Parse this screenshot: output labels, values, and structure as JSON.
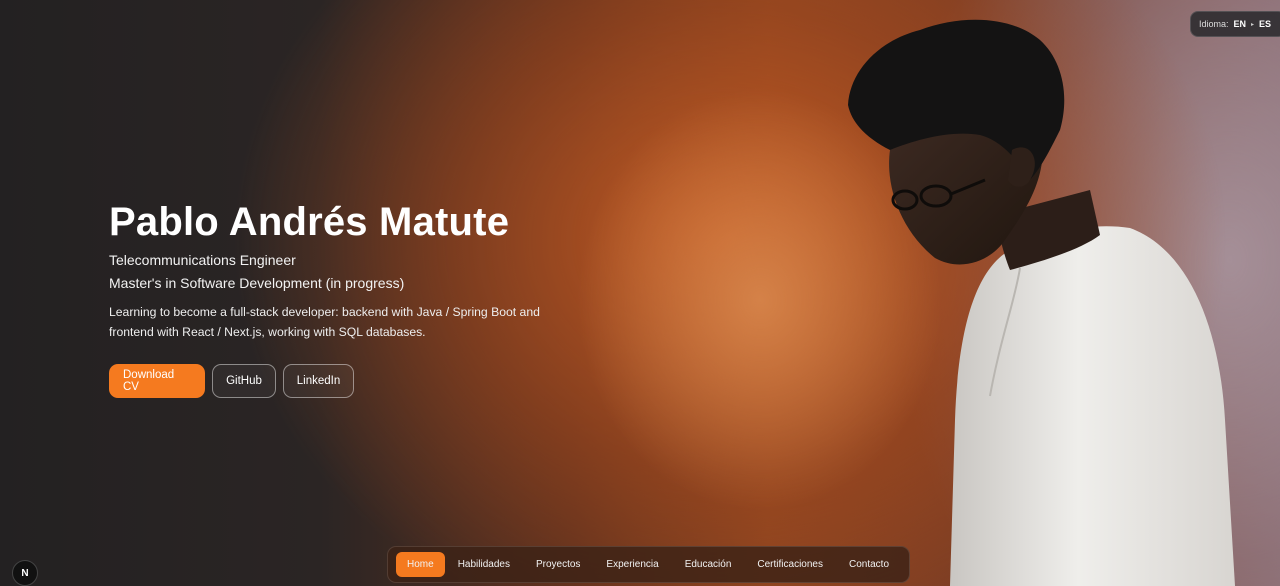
{
  "language": {
    "label": "Idioma:",
    "options": [
      "EN",
      "ES"
    ],
    "active": "EN"
  },
  "hero": {
    "name": "Pablo Andrés Matute",
    "subtitle1": "Telecommunications Engineer",
    "subtitle2": "Master's in Software Development (in progress)",
    "description": "Learning to become a full-stack developer: backend with Java / Spring Boot and frontend with React / Next.js, working with SQL databases."
  },
  "buttons": {
    "download_cv": "Download CV",
    "github": "GitHub",
    "linkedin": "LinkedIn"
  },
  "nav": {
    "items": [
      "Home",
      "Habilidades",
      "Proyectos",
      "Experiencia",
      "Educación",
      "Certificaciones",
      "Contacto"
    ],
    "active": "Home"
  },
  "badge": {
    "letter": "N"
  },
  "colors": {
    "accent": "#f57a1f",
    "shirt": "#e9e7e3",
    "hair": "#141313"
  }
}
